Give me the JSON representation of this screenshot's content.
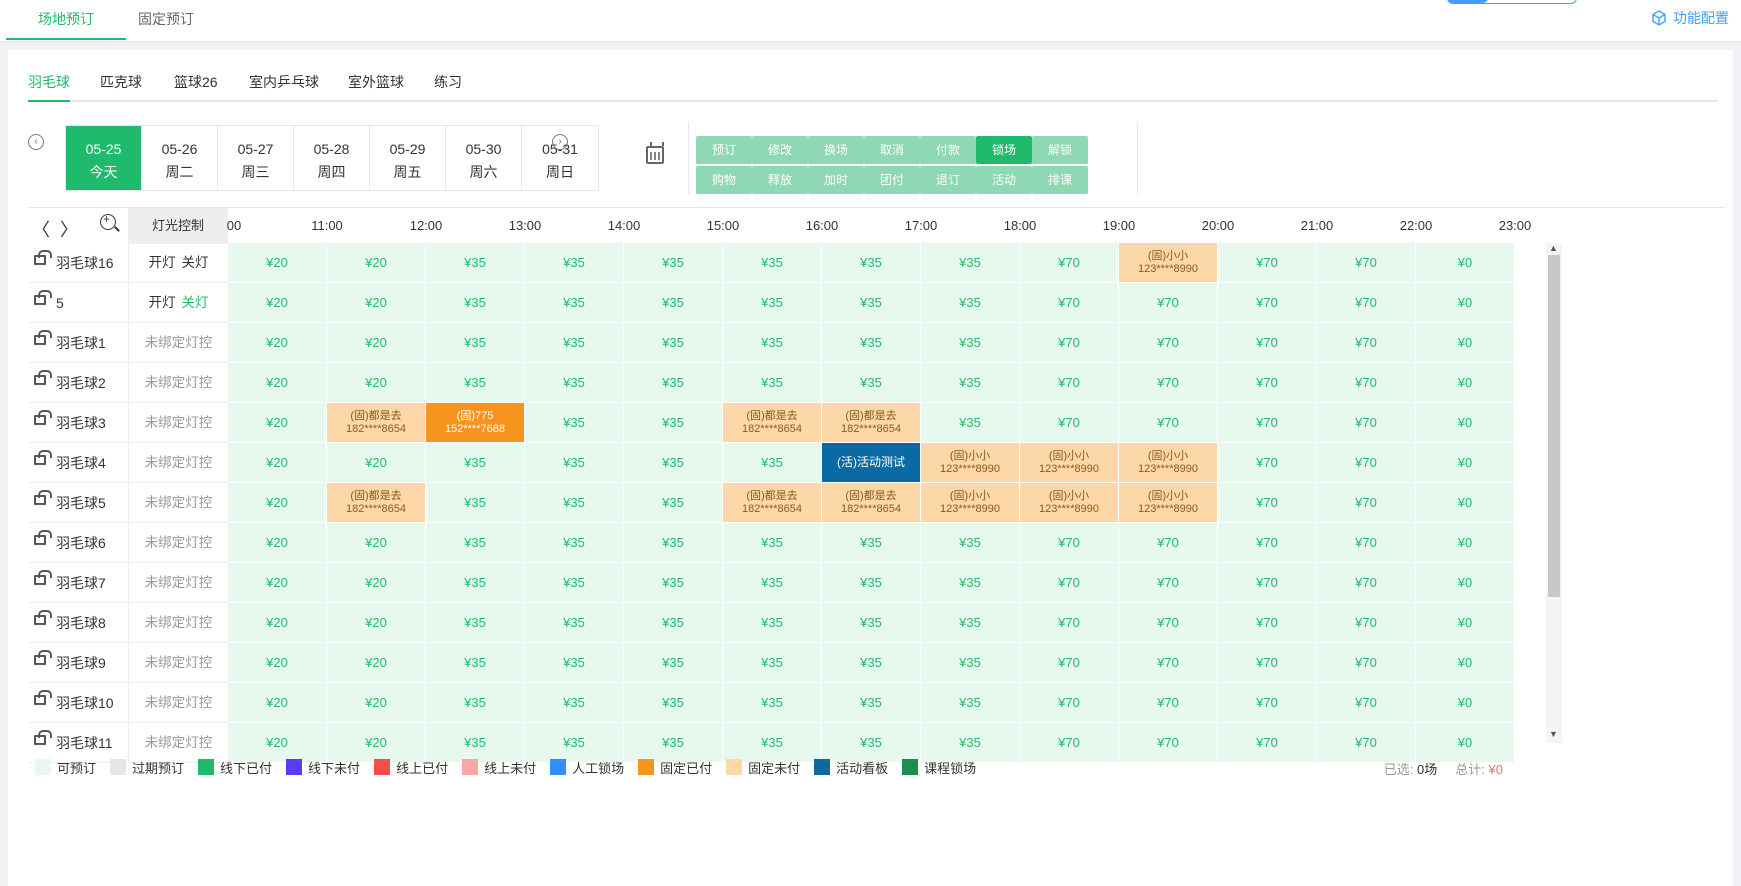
{
  "top_tabs": [
    {
      "label": "场地预订",
      "active": true
    },
    {
      "label": "固定预订",
      "active": false
    }
  ],
  "func_config": "功能配置",
  "sport_tabs": [
    "羽毛球",
    "匹克球",
    "篮球26",
    "室内乒乓球",
    "室外篮球",
    "练习"
  ],
  "dates": [
    {
      "date": "05-25",
      "day": "今天",
      "active": true
    },
    {
      "date": "05-26",
      "day": "周二"
    },
    {
      "date": "05-27",
      "day": "周三"
    },
    {
      "date": "05-28",
      "day": "周四"
    },
    {
      "date": "05-29",
      "day": "周五"
    },
    {
      "date": "05-30",
      "day": "周六"
    },
    {
      "date": "05-31",
      "day": "周日"
    }
  ],
  "actions_row1": [
    "预订",
    "修改",
    "换场",
    "取消",
    "付款",
    "锁场",
    "解锁"
  ],
  "actions_row2": [
    "购物",
    "释放",
    "加时",
    "团付",
    "退订",
    "活动",
    "排课"
  ],
  "light_control_header": "灯光控制",
  "hours": [
    "00",
    "11:00",
    "12:00",
    "13:00",
    "14:00",
    "15:00",
    "16:00",
    "17:00",
    "18:00",
    "19:00",
    "20:00",
    "21:00",
    "22:00",
    "23:00"
  ],
  "courts": [
    {
      "name": "羽毛球16",
      "light": "开灯 关灯",
      "light_on": "开灯",
      "light_off": "关灯",
      "off_green": false
    },
    {
      "name": "5",
      "light": "开灯 关灯",
      "light_on": "开灯",
      "light_off": "关灯",
      "off_green": true
    },
    {
      "name": "羽毛球1",
      "light": "未绑定灯控"
    },
    {
      "name": "羽毛球2",
      "light": "未绑定灯控"
    },
    {
      "name": "羽毛球3",
      "light": "未绑定灯控"
    },
    {
      "name": "羽毛球4",
      "light": "未绑定灯控"
    },
    {
      "name": "羽毛球5",
      "light": "未绑定灯控"
    },
    {
      "name": "羽毛球6",
      "light": "未绑定灯控"
    },
    {
      "name": "羽毛球7",
      "light": "未绑定灯控"
    },
    {
      "name": "羽毛球8",
      "light": "未绑定灯控"
    },
    {
      "name": "羽毛球9",
      "light": "未绑定灯控"
    },
    {
      "name": "羽毛球10",
      "light": "未绑定灯控"
    },
    {
      "name": "羽毛球11",
      "light": "未绑定灯控"
    }
  ],
  "default_prices": [
    "¥20",
    "¥20",
    "¥35",
    "¥35",
    "¥35",
    "¥35",
    "¥35",
    "¥35",
    "¥70",
    "¥70",
    "¥70",
    "¥70",
    "¥0"
  ],
  "bookings": [
    {
      "row": 0,
      "col": 9,
      "type": "fixed-unpaid",
      "line1": "(固)小小",
      "line2": "123****8990"
    },
    {
      "row": 4,
      "col": 1,
      "type": "fixed-unpaid",
      "line1": "(固)都是去",
      "line2": "182****8654"
    },
    {
      "row": 4,
      "col": 2,
      "type": "fixed-paid",
      "line1": "(固)775",
      "line2": "152****7688"
    },
    {
      "row": 4,
      "col": 5,
      "type": "fixed-unpaid",
      "line1": "(固)都是去",
      "line2": "182****8654"
    },
    {
      "row": 4,
      "col": 6,
      "type": "fixed-unpaid",
      "line1": "(固)都是去",
      "line2": "182****8654"
    },
    {
      "row": 5,
      "col": 6,
      "type": "activity",
      "line1": "(活)活动测试",
      "line2": ""
    },
    {
      "row": 5,
      "col": 7,
      "type": "fixed-unpaid",
      "line1": "(固)小小",
      "line2": "123****8990"
    },
    {
      "row": 5,
      "col": 8,
      "type": "fixed-unpaid",
      "line1": "(固)小小",
      "line2": "123****8990"
    },
    {
      "row": 5,
      "col": 9,
      "type": "fixed-unpaid",
      "line1": "(固)小小",
      "line2": "123****8990"
    },
    {
      "row": 6,
      "col": 1,
      "type": "fixed-unpaid",
      "line1": "(固)都是去",
      "line2": "182****8654"
    },
    {
      "row": 6,
      "col": 5,
      "type": "fixed-unpaid",
      "line1": "(固)都是去",
      "line2": "182****8654"
    },
    {
      "row": 6,
      "col": 6,
      "type": "fixed-unpaid",
      "line1": "(固)都是去",
      "line2": "182****8654"
    },
    {
      "row": 6,
      "col": 7,
      "type": "fixed-unpaid",
      "line1": "(固)小小",
      "line2": "123****8990"
    },
    {
      "row": 6,
      "col": 8,
      "type": "fixed-unpaid",
      "line1": "(固)小小",
      "line2": "123****8990"
    },
    {
      "row": 6,
      "col": 9,
      "type": "fixed-unpaid",
      "line1": "(固)小小",
      "line2": "123****8990"
    }
  ],
  "legend": [
    {
      "label": "可预订",
      "color": "#e7f9ee"
    },
    {
      "label": "过期预订",
      "color": "#e6e6e6"
    },
    {
      "label": "线下已付",
      "color": "#1fba6b"
    },
    {
      "label": "线下未付",
      "color": "#5b3cf5"
    },
    {
      "label": "线上已付",
      "color": "#f24e4e"
    },
    {
      "label": "线上未付",
      "color": "#f7a8a2"
    },
    {
      "label": "人工锁场",
      "color": "#2f90ff"
    },
    {
      "label": "固定已付",
      "color": "#f7941d"
    },
    {
      "label": "固定未付",
      "color": "#fcd8a9"
    },
    {
      "label": "活动看板",
      "color": "#0b6aa1"
    },
    {
      "label": "课程锁场",
      "color": "#1a8f4f"
    }
  ],
  "summary": {
    "selected_label": "已选:",
    "selected_value": "0场",
    "total_label": "总计:",
    "total_value": "¥0"
  }
}
